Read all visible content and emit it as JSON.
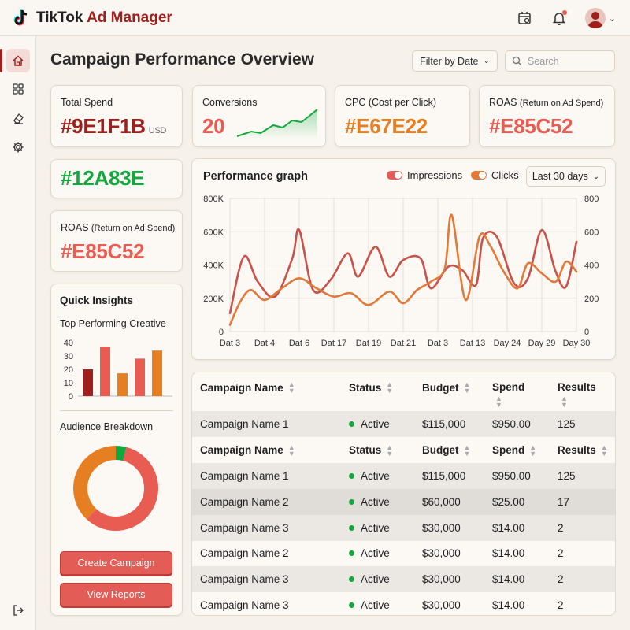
{
  "app": {
    "name_part1": "TikTok",
    "name_part2": "Ad Manager"
  },
  "header": {
    "icons": [
      "calendar-icon",
      "bell-icon",
      "avatar",
      "chevron-down-icon"
    ]
  },
  "sidebar": {
    "items": [
      "home-icon",
      "grid-icon",
      "eraser-icon",
      "gear-icon"
    ],
    "bottom": "logout-icon",
    "active": 0
  },
  "page": {
    "title": "Campaign Performance Overview",
    "filter_label": "Filter by Date",
    "search_placeholder": "Search"
  },
  "kpis": [
    {
      "label": "Total Spend",
      "value": "#9E1F1B",
      "unit": "USD",
      "color": "#9E1F1B"
    },
    {
      "label": "Conversions",
      "value": "20",
      "color": "#E85C52"
    },
    {
      "label": "CPC (Cost per Click)",
      "value": "#E67E22",
      "color": "#E67E22"
    },
    {
      "label_main": "ROAS",
      "label_small": "(Return on Ad Spend)",
      "value": "#E85C52",
      "color": "#E85C52"
    }
  ],
  "kpi_extra": {
    "value": "#12A83E",
    "color": "#12A83E"
  },
  "kpi_roas2": {
    "label_main": "ROAS",
    "label_small": "(Return on Ad Spend)",
    "value": "#E85C52",
    "color": "#E85C52"
  },
  "quick_insights": {
    "title": "Quick Insights",
    "top_creative_label": "Top Performing Creative",
    "audience_label": "Audience Breakdown",
    "create_button": "Create Campaign",
    "reports_button": "View Reports"
  },
  "performance": {
    "title": "Performance graph",
    "legend": [
      "Impressions",
      "Clicks"
    ],
    "range_label": "Last 30 days"
  },
  "chart_data": [
    {
      "type": "line",
      "title": "Performance graph",
      "x": [
        "Dat 3",
        "Dat 4",
        "Dat 6",
        "Dat 17",
        "Dat 19",
        "Dat 21",
        "Dat 3",
        "Dat 13",
        "Day 24",
        "Day 29",
        "Day 30"
      ],
      "y_left_ticks": [
        "0",
        "200K",
        "400K",
        "600K",
        "800K"
      ],
      "y_right_ticks": [
        "0",
        "200",
        "400",
        "600",
        "800"
      ],
      "ylim_left": [
        0,
        800000
      ],
      "ylim_right": [
        0,
        800
      ],
      "series": [
        {
          "name": "Impressions",
          "axis": "left",
          "color": "#C8524A",
          "points": [
            [
              0,
              110000
            ],
            [
              0.4,
              450000
            ],
            [
              0.8,
              300000
            ],
            [
              1.3,
              210000
            ],
            [
              1.8,
              440000
            ],
            [
              2.0,
              610000
            ],
            [
              2.4,
              250000
            ],
            [
              2.9,
              310000
            ],
            [
              3.4,
              470000
            ],
            [
              3.7,
              330000
            ],
            [
              4.2,
              510000
            ],
            [
              4.6,
              330000
            ],
            [
              5.0,
              430000
            ],
            [
              5.5,
              440000
            ],
            [
              5.8,
              260000
            ],
            [
              6.3,
              390000
            ],
            [
              6.7,
              370000
            ],
            [
              7.1,
              280000
            ],
            [
              7.3,
              560000
            ],
            [
              7.7,
              570000
            ],
            [
              8.2,
              290000
            ],
            [
              8.6,
              320000
            ],
            [
              9.0,
              610000
            ],
            [
              9.4,
              360000
            ],
            [
              9.7,
              270000
            ],
            [
              10.0,
              540000
            ]
          ]
        },
        {
          "name": "Clicks",
          "axis": "right",
          "color": "#E0793A",
          "points": [
            [
              0,
              40
            ],
            [
              0.3,
              180
            ],
            [
              0.6,
              250
            ],
            [
              1.0,
              190
            ],
            [
              1.5,
              260
            ],
            [
              2.0,
              320
            ],
            [
              2.5,
              260
            ],
            [
              3.0,
              210
            ],
            [
              3.5,
              230
            ],
            [
              4.0,
              160
            ],
            [
              4.6,
              240
            ],
            [
              5.0,
              170
            ],
            [
              5.4,
              250
            ],
            [
              5.8,
              300
            ],
            [
              6.2,
              380
            ],
            [
              6.4,
              700
            ],
            [
              6.8,
              190
            ],
            [
              7.2,
              570
            ],
            [
              7.5,
              520
            ],
            [
              7.9,
              360
            ],
            [
              8.3,
              260
            ],
            [
              8.6,
              410
            ],
            [
              9.0,
              350
            ],
            [
              9.4,
              300
            ],
            [
              9.7,
              420
            ],
            [
              10.0,
              360
            ]
          ]
        }
      ]
    },
    {
      "type": "bar",
      "title": "Top Performing Creative",
      "y_ticks": [
        "0",
        "10",
        "20",
        "30",
        "40"
      ],
      "ylim": [
        0,
        40
      ],
      "values": [
        20,
        37,
        17,
        28,
        34
      ],
      "colors": [
        "#9E1F1B",
        "#E85C52",
        "#E67E22",
        "#E85C52",
        "#E67E22"
      ]
    },
    {
      "type": "pie",
      "title": "Audience Breakdown",
      "values": [
        58,
        38,
        4
      ],
      "colors": [
        "#E85C52",
        "#E67E22",
        "#12A83E"
      ]
    }
  ],
  "table": {
    "columns": [
      "Campaign Name",
      "Status",
      "Budget",
      "Spend",
      "Results"
    ],
    "rows": [
      {
        "type": "data",
        "name": "Campaign Name 1",
        "status": "Active",
        "budget": "$115,000",
        "spend": "$950.00",
        "results": "125"
      },
      {
        "type": "header"
      },
      {
        "type": "data",
        "name": "Campaign Name 1",
        "status": "Active",
        "budget": "$115,000",
        "spend": "$950.00",
        "results": "125"
      },
      {
        "type": "data",
        "name": "Campaign Name 2",
        "status": "Active",
        "budget": "$60,000",
        "spend": "$25.00",
        "results": "17"
      },
      {
        "type": "data",
        "name": "Campaign Name 3",
        "status": "Active",
        "budget": "$30,000",
        "spend": "$14.00",
        "results": "2"
      },
      {
        "type": "data",
        "name": "Campaign Name 2",
        "status": "Active",
        "budget": "$30,000",
        "spend": "$14.00",
        "results": "2"
      },
      {
        "type": "data",
        "name": "Campaign Name 3",
        "status": "Active",
        "budget": "$30,000",
        "spend": "$14.00",
        "results": "2"
      },
      {
        "type": "data",
        "name": "Campaign Name 3",
        "status": "Active",
        "budget": "$30,000",
        "spend": "$14.00",
        "results": "2"
      }
    ]
  }
}
